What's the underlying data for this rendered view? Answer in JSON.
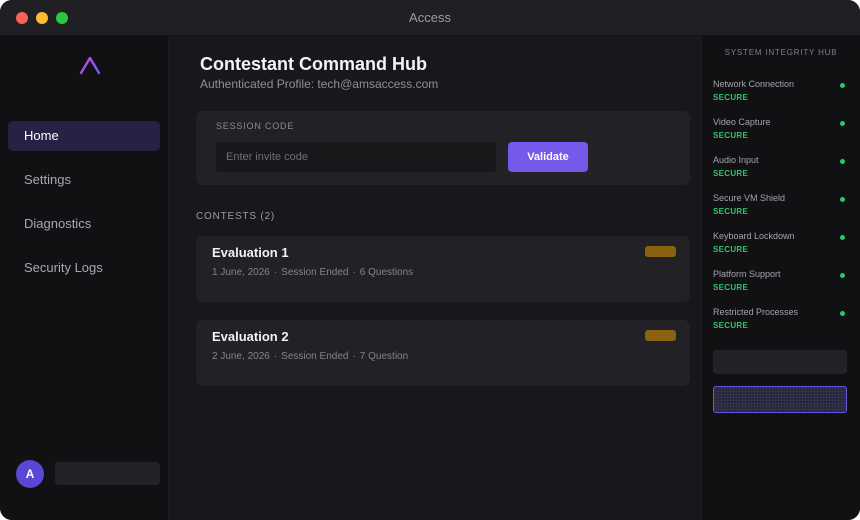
{
  "window": {
    "title": "Access"
  },
  "sidebar": {
    "items": [
      {
        "label": "Home",
        "active": true
      },
      {
        "label": "Settings",
        "active": false
      },
      {
        "label": "Diagnostics",
        "active": false
      },
      {
        "label": "Security Logs",
        "active": false
      }
    ],
    "avatar_initial": "A",
    "accent_color": "#7459ea"
  },
  "header": {
    "title": "Contestant Command Hub",
    "subtitle": "Authenticated Profile: tech@amsaccess.com"
  },
  "session": {
    "label": "SESSION CODE",
    "placeholder": "Enter invite code",
    "value": "",
    "button_label": "Validate"
  },
  "contests": {
    "heading": "CONTESTS (2)",
    "items": [
      {
        "title": "Evaluation 1",
        "date": "1 June, 2026",
        "status": "Session Ended",
        "questions": "6 Questions",
        "badge_color": "#8a6310"
      },
      {
        "title": "Evaluation 2",
        "date": "2 June, 2026",
        "status": "Session Ended",
        "questions": "7 Question",
        "badge_color": "#8a6310"
      }
    ]
  },
  "integrity": {
    "title": "SYSTEM INTEGRITY HUB",
    "status_color": "#2fc66a",
    "checks": [
      {
        "name": "Network Connection",
        "status": "SECURE"
      },
      {
        "name": "Video Capture",
        "status": "SECURE"
      },
      {
        "name": "Audio Input",
        "status": "SECURE"
      },
      {
        "name": "Secure VM Shield",
        "status": "SECURE"
      },
      {
        "name": "Keyboard Lockdown",
        "status": "SECURE"
      },
      {
        "name": "Platform Support",
        "status": "SECURE"
      },
      {
        "name": "Restricted Processes",
        "status": "SECURE"
      }
    ]
  }
}
